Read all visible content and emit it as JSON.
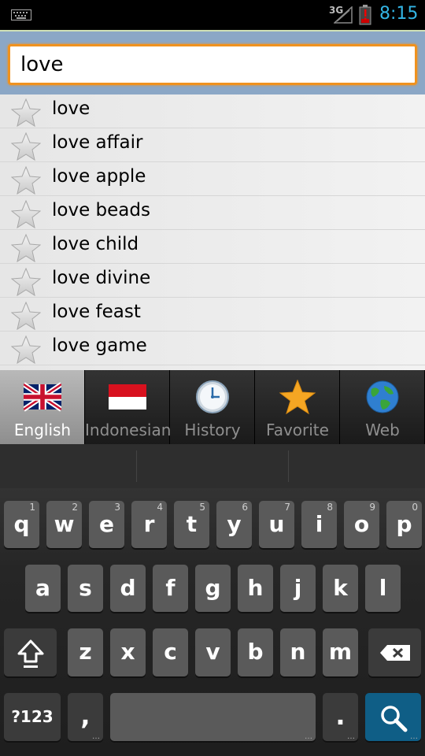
{
  "status_bar": {
    "network_type": "3G",
    "time": "8:15",
    "icons": [
      "keyboard-notification-icon",
      "signal-icon",
      "battery-alert-icon"
    ]
  },
  "search": {
    "value": "love"
  },
  "words": [
    {
      "label": "love"
    },
    {
      "label": "love affair"
    },
    {
      "label": "love apple"
    },
    {
      "label": "love beads"
    },
    {
      "label": "love child"
    },
    {
      "label": "love divine"
    },
    {
      "label": "love feast"
    },
    {
      "label": "love game"
    }
  ],
  "tabs": [
    {
      "label": "English",
      "icon": "uk-flag-icon",
      "active": true
    },
    {
      "label": "Indonesian",
      "icon": "indonesia-flag-icon",
      "active": false
    },
    {
      "label": "History",
      "icon": "clock-icon",
      "active": false
    },
    {
      "label": "Favorite",
      "icon": "star-icon",
      "active": false
    },
    {
      "label": "Web",
      "icon": "globe-icon",
      "active": false
    }
  ],
  "keyboard": {
    "row1": [
      {
        "key": "q",
        "hint": "1"
      },
      {
        "key": "w",
        "hint": "2"
      },
      {
        "key": "e",
        "hint": "3"
      },
      {
        "key": "r",
        "hint": "4"
      },
      {
        "key": "t",
        "hint": "5"
      },
      {
        "key": "y",
        "hint": "6"
      },
      {
        "key": "u",
        "hint": "7"
      },
      {
        "key": "i",
        "hint": "8"
      },
      {
        "key": "o",
        "hint": "9"
      },
      {
        "key": "p",
        "hint": "0"
      }
    ],
    "row2": [
      "a",
      "s",
      "d",
      "f",
      "g",
      "h",
      "j",
      "k",
      "l"
    ],
    "row3": [
      "z",
      "x",
      "c",
      "v",
      "b",
      "n",
      "m"
    ],
    "symbols_label": "?123",
    "comma_label": ",",
    "period_label": ".",
    "shift_icon": "shift-icon",
    "backspace_icon": "backspace-icon",
    "search_icon": "search-icon"
  },
  "colors": {
    "accent_orange": "#f0921f",
    "header_blue": "#8ba7c6",
    "clock_blue": "#33b5e5",
    "search_key_blue": "#0f5e86"
  }
}
